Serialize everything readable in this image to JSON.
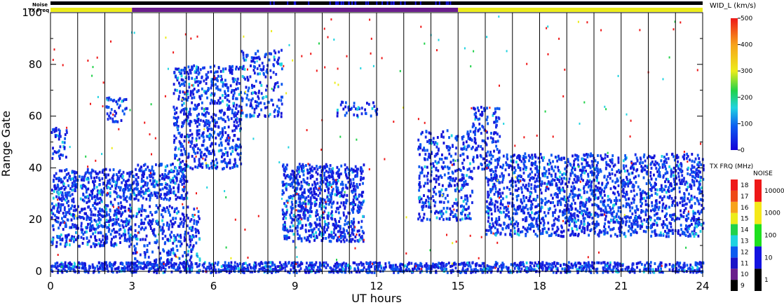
{
  "chart_data": [
    {
      "type": "heatmap",
      "title": "",
      "xlabel": "UT hours",
      "ylabel": "Range Gate",
      "xlim": [
        0,
        24
      ],
      "ylim": [
        0,
        100
      ],
      "x_ticks": [
        "0",
        "3",
        "6",
        "9",
        "12",
        "15",
        "18",
        "21",
        "24"
      ],
      "x_minor_step": 1,
      "y_ticks": [
        "0",
        "20",
        "40",
        "60",
        "80",
        "100"
      ],
      "grid": "vertical lines each hour",
      "value_label": "WID_L (km/s)",
      "colorbar": {
        "label": "WID_L (km/s)",
        "ticks": [
          "0",
          "100",
          "200",
          "300",
          "400",
          "500"
        ],
        "range": [
          0,
          500
        ]
      },
      "scatter_regions": [
        {
          "x0": 0.0,
          "x1": 3.0,
          "y0": 10,
          "y1": 40,
          "density": 0.55
        },
        {
          "x0": 0.0,
          "x1": 0.6,
          "y0": 44,
          "y1": 56,
          "density": 0.35
        },
        {
          "x0": 2.0,
          "x1": 2.8,
          "y0": 58,
          "y1": 68,
          "density": 0.35
        },
        {
          "x0": 3.0,
          "x1": 5.0,
          "y0": 28,
          "y1": 42,
          "density": 0.6
        },
        {
          "x0": 3.0,
          "x1": 5.5,
          "y0": 2,
          "y1": 26,
          "density": 0.35
        },
        {
          "x0": 4.5,
          "x1": 7.0,
          "y0": 40,
          "y1": 80,
          "density": 0.45
        },
        {
          "x0": 7.0,
          "x1": 8.5,
          "y0": 60,
          "y1": 86,
          "density": 0.3
        },
        {
          "x0": 8.5,
          "x1": 11.5,
          "y0": 12,
          "y1": 42,
          "density": 0.6
        },
        {
          "x0": 10.5,
          "x1": 12.0,
          "y0": 60,
          "y1": 66,
          "density": 0.3
        },
        {
          "x0": 13.5,
          "x1": 15.5,
          "y0": 20,
          "y1": 55,
          "density": 0.35
        },
        {
          "x0": 15.5,
          "x1": 16.5,
          "y0": 40,
          "y1": 64,
          "density": 0.35
        },
        {
          "x0": 16.0,
          "x1": 24.0,
          "y0": 14,
          "y1": 46,
          "density": 0.5
        },
        {
          "x0": 0.0,
          "x1": 24.0,
          "y0": 0,
          "y1": 4,
          "density": 0.95
        }
      ],
      "status_bars": {
        "noise_label": "Noise",
        "txfreq_label": "TX Freq",
        "txfreq_segments": [
          {
            "from": 0,
            "to": 3,
            "freq_mhz": 15
          },
          {
            "from": 3,
            "to": 15,
            "freq_mhz": 10
          },
          {
            "from": 15,
            "to": 24,
            "freq_mhz": 15
          }
        ]
      }
    },
    {
      "type": "heatmap",
      "title": "",
      "colorbar_label": "TX FRQ (MHz)",
      "ticks": [
        "9",
        "10",
        "11",
        "12",
        "13",
        "14",
        "15",
        "16",
        "17",
        "18"
      ],
      "colors": [
        "#000000",
        "#6a1d8c",
        "#1a12c8",
        "#0c5cf0",
        "#1fd3e0",
        "#21d24a",
        "#ecec1a",
        "#f7a21a",
        "#ef4a16",
        "#ee1818"
      ]
    },
    {
      "type": "heatmap",
      "title": "",
      "colorbar_label": "NOISE",
      "ticks": [
        "1",
        "10",
        "100",
        "1000",
        "10000"
      ],
      "colors": [
        "#000000",
        "#1212e0",
        "#1ee01e",
        "#f5e81a",
        "#ee1818"
      ]
    }
  ]
}
